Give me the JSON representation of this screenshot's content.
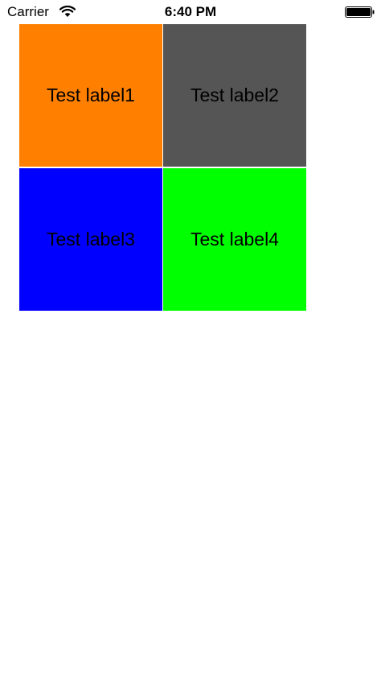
{
  "status_bar": {
    "carrier": "Carrier",
    "time": "6:40 PM",
    "wifi_icon": "wifi-icon",
    "battery_icon": "battery-icon"
  },
  "grid": {
    "cells": [
      {
        "label": "Test label1",
        "color": "#FF8000"
      },
      {
        "label": "Test label2",
        "color": "#555555"
      },
      {
        "label": "Test label3",
        "color": "#0000FF"
      },
      {
        "label": "Test label4",
        "color": "#00FF00"
      }
    ]
  }
}
